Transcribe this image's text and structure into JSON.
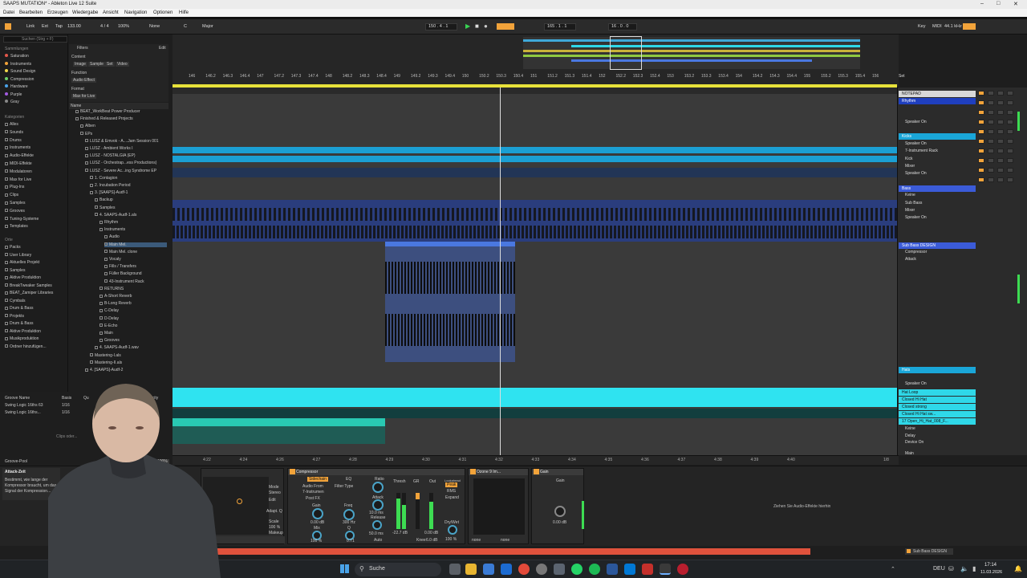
{
  "window": {
    "title": "SAAPS MUTATION* - Ableton Live 12 Suite"
  },
  "menu": [
    "Datei",
    "Bearbeiten",
    "Erzeugen",
    "Wiedergabe",
    "Ansicht",
    "Navigation",
    "Optionen",
    "Hilfe"
  ],
  "transport": {
    "link": "Link",
    "ext": "Ext",
    "tap": "Tap",
    "tempo": "133.00",
    "signature": "4 / 4",
    "zoom": "100%",
    "quantize": "None",
    "key_root": "C",
    "key_scale": "Major",
    "position": "150 . 4 . 1",
    "loop_start": "165 . 1 . 1",
    "loop_len": "16 . 0 . 0",
    "key_label": "Key",
    "midi_label": "MIDI",
    "sample_rate": "44.1 kHz"
  },
  "browser": {
    "search_placeholder": "Suchen (Strg + F)",
    "collections_header": "Sammlungen",
    "collections": [
      {
        "label": "Saturation",
        "color": "#e4584b"
      },
      {
        "label": "Instruments",
        "color": "#f2a33a"
      },
      {
        "label": "Sound Design",
        "color": "#f0d74a"
      },
      {
        "label": "Compression",
        "color": "#6cd16a"
      },
      {
        "label": "Hardware",
        "color": "#4aa3e8"
      },
      {
        "label": "Purple",
        "color": "#a35be0"
      },
      {
        "label": "Gray",
        "color": "#888888"
      }
    ],
    "categories_header": "Kategorien",
    "categories": [
      "Alles",
      "Sounds",
      "Drums",
      "Instruments",
      "Audio-Effekte",
      "MIDI-Effekte",
      "Modulatoren",
      "Max for Live",
      "Plug-Ins",
      "Clips",
      "Samples",
      "Grooves",
      "Tuning-Systeme",
      "Templates"
    ],
    "places_header": "Orte",
    "places": [
      "Packs",
      "User Library",
      "Aktuelles Projekt",
      "Samples",
      "Aktive Produktion",
      "BreakTweaker Samples",
      "BEAT_Zamiper Libraries",
      "Cymbals",
      "Drum & Bass",
      "Projekts",
      "Drum & Bass",
      "Aktive Produktion",
      "Musikproduktion",
      "Ordner hinzufügen..."
    ],
    "filters": {
      "header": "Filters",
      "edit": "Edit",
      "content": "Content",
      "content_tags": [
        "Image",
        "Sample",
        "Set",
        "Video"
      ],
      "function": "Function",
      "function_tags": [
        "Audio Effect"
      ],
      "format": "Format",
      "format_tags": [
        "Max for Live"
      ]
    },
    "name_header": "Name",
    "tree": [
      "BEAT_WorkBeat Power Producer",
      "Finished & Released Projects",
      "Alben",
      "EPs",
      "LUSZ & Emvok - A....Jam Session 001",
      "LUSZ - Ambient Works I",
      "LUSZ - NOSTALGIA (EP)",
      "LUSZ - Orchestrap...ess Productions)",
      "LUSZ - Severe Ac...ing Syndrome EP",
      "1. Contagion",
      "2. Incubation Period",
      "3. [SAAPS]-Audf-1",
      "Backup",
      "Samples",
      "4. SAAPS-Audf-1.als",
      "Rhythm",
      "Instruments",
      "Audio",
      "Main Mel.",
      "Main Mel. clone",
      "Vocaly",
      "Fills / Transfers",
      "Füller Background",
      "43-Instrument Rack",
      "RETURNS",
      "A-Short Reverb",
      "B-Long Reverb",
      "C-Delay",
      "D-Delay",
      "E-Echo",
      "Main",
      "Grooves",
      "4. SAAPS-Audf-1.wav",
      "Mastering-I.als",
      "Mastering-II.als",
      "4. [SAAPS]-Audf-2"
    ]
  },
  "groove_pool": {
    "header_name": "Groove Name",
    "header_base": "Basis",
    "header_q": "Qu",
    "header_v": "Velocity",
    "rows": [
      {
        "name": "Swing Logic 16ths 63",
        "base": "1/16"
      },
      {
        "name": "Swing Logic 16ths...",
        "base": "1/16"
      }
    ],
    "hint": "Clips oder...",
    "footer": "Groove-Pool",
    "amount": "100%"
  },
  "ruler": {
    "bars": [
      "146",
      "146.2",
      "146.3",
      "146.4",
      "147",
      "147.2",
      "147.3",
      "147.4",
      "148",
      "148.2",
      "148.3",
      "148.4",
      "149",
      "149.2",
      "149.3",
      "149.4",
      "150",
      "150.2",
      "150.3",
      "150.4",
      "151",
      "151.2",
      "151.3",
      "151.4",
      "152",
      "152.2",
      "152.3",
      "152.4",
      "153",
      "153.2",
      "153.3",
      "153.4",
      "154",
      "154.2",
      "154.3",
      "154.4",
      "155",
      "155.2",
      "155.3",
      "155.4",
      "156"
    ],
    "set_label": "Set"
  },
  "bottom_ruler": {
    "times": [
      "4:22",
      "4:24",
      "4:26",
      "4:27",
      "4:28",
      "4:29",
      "4:30",
      "4:31",
      "4:32",
      "4:33",
      "4:34",
      "4:35",
      "4:36",
      "4:37",
      "4:38",
      "4:39",
      "4:40"
    ],
    "page": "1/8"
  },
  "mixer": {
    "tracks": [
      {
        "name": "NOTEPAD",
        "color": "#d8d8d8"
      },
      {
        "name": "Rhythm",
        "color": "#1f3fbf"
      },
      {
        "name": "Speaker On",
        "color": ""
      },
      {
        "name": "Kicks",
        "color": "#1aa6d8"
      },
      {
        "name": "Speaker On",
        "color": ""
      },
      {
        "name": "7-Instrument Rack",
        "color": ""
      },
      {
        "name": "Kick",
        "color": ""
      },
      {
        "name": "Mixer",
        "color": ""
      },
      {
        "name": "Speaker On",
        "color": ""
      },
      {
        "name": "Bass",
        "color": "#3b5bd8"
      },
      {
        "name": "Keine",
        "color": ""
      },
      {
        "name": "Sub Bass",
        "color": ""
      },
      {
        "name": "Mixer",
        "color": ""
      },
      {
        "name": "Speaker On",
        "color": ""
      },
      {
        "name": "Sub Bass DESIGN",
        "color": "#3b5bd8"
      },
      {
        "name": "Compressor",
        "color": ""
      },
      {
        "name": "Attack",
        "color": ""
      },
      {
        "name": "Hats",
        "color": "#1aa6d8"
      },
      {
        "name": "Speaker On",
        "color": ""
      },
      {
        "name": "Hat Loop",
        "color": "#2fd8e8"
      },
      {
        "name": "Closed Hi Hat",
        "color": "#2fd8e8"
      },
      {
        "name": "Closed strong",
        "color": "#2fd8e8"
      },
      {
        "name": "Closed Hi Hat sw...",
        "color": "#2fd8e8"
      },
      {
        "name": "17 Open_Hi_Hat_008_F...",
        "color": "#2fd8e8"
      },
      {
        "name": "Keine",
        "color": ""
      },
      {
        "name": "Delay",
        "color": ""
      },
      {
        "name": "Device On",
        "color": ""
      },
      {
        "name": "Main",
        "color": ""
      }
    ]
  },
  "devices": {
    "info_title": "Attack-Zeit",
    "info_text": "Bestimmt, wie lange der Kompressor braucht, um das Signal der Kompression...",
    "compressor": {
      "title": "Compressor",
      "sidechain": "Sidechain",
      "eq": "EQ",
      "audio_from": "Audio From",
      "audio_from_value": "7-Instrumen",
      "post_fx": "Post FX",
      "filter_type": "Filter Type",
      "gain": "Gain",
      "gain_value": "0.00 dB",
      "mix": "Mix",
      "mix_value": "100 %",
      "freq": "Freq",
      "freq_value": "300 Hz",
      "q": "Q",
      "q_value": "0.71",
      "ratio": "Ratio",
      "attack": "Attack",
      "attack_value": "10.0 ms",
      "release": "Release",
      "release_value": "50.0 ms",
      "auto": "Auto",
      "thresh": "Thresh",
      "gr": "GR",
      "out": "Out",
      "thresh_value": "-22.7 dB",
      "out_value": "0.00 dB",
      "mode": "Mode",
      "stereo": "Stereo",
      "edit": "Edit",
      "makeup": "Makeup",
      "peak": "Peak",
      "rms": "RMS",
      "expand": "Expand",
      "knee": "Knee",
      "knee_value": "6.0 dB",
      "lookahead": "Lookahead",
      "dry_wet": "Dry/Wet",
      "dry_wet_value": "100 %",
      "scale": "Scale",
      "scale_value": "100 %",
      "adapt": "Adapt. Q"
    },
    "ozone": {
      "title": "Ozone 9 Im...",
      "none1": "none",
      "none2": "none"
    },
    "gain": {
      "title": "Gain",
      "label": "Gain",
      "value": "0.00 dB"
    },
    "drop_hint": "Ziehen Sie Audio-Effekte hierhin"
  },
  "status": {
    "track": "Sub Bass DESIGN"
  },
  "taskbar": {
    "search": "Suche",
    "lang": "DEU",
    "time": "17:14",
    "date": "11.03.2026"
  }
}
